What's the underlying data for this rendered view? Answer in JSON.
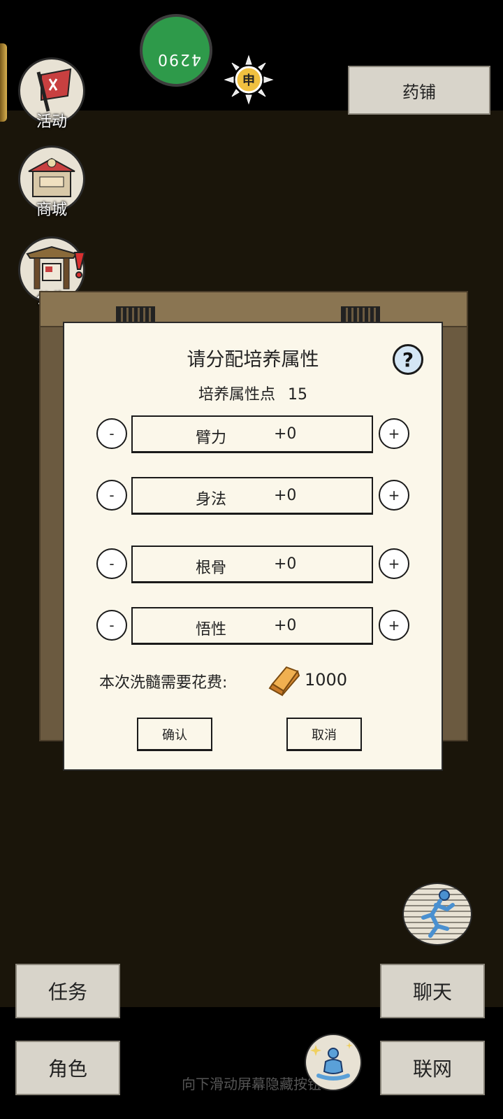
{
  "top": {
    "green_badge_text": "4290",
    "sun_glyph": "申",
    "shop_label": "药铺"
  },
  "side_menu": [
    {
      "label": "活动",
      "icon": "event-flag-icon"
    },
    {
      "label": "商城",
      "icon": "shop-stall-icon"
    },
    {
      "label": "公告",
      "icon": "notice-gate-icon"
    }
  ],
  "dialog": {
    "title": "请分配培养属性",
    "points_label": "培养属性点",
    "points_value": "15",
    "minus_label": "-",
    "plus_label": "+",
    "attributes": [
      {
        "name": "臂力",
        "value": "+0"
      },
      {
        "name": "身法",
        "value": "+0"
      },
      {
        "name": "根骨",
        "value": "+0"
      },
      {
        "name": "悟性",
        "value": "+0"
      }
    ],
    "cost_label": "本次洗髓需要花费:",
    "cost_value": "1000",
    "confirm_label": "确认",
    "cancel_label": "取消",
    "help_label": "?"
  },
  "bottom_menu": {
    "task": "任务",
    "role": "角色",
    "chat": "聊天",
    "network": "联网",
    "swipe_hint": "向下滑动屏幕隐藏按钮"
  },
  "colors": {
    "background": "#1a150a",
    "dialog_bg": "#fbf7ea",
    "button_bg": "#d8d4ca",
    "gold": "#e8a040"
  }
}
